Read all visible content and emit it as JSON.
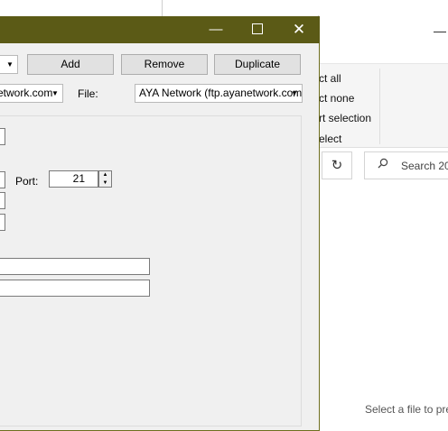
{
  "dialog": {
    "caption_buttons": {
      "minimize": "—",
      "close": "✕"
    },
    "top_combo": {
      "value": ""
    },
    "buttons": {
      "add": "Add",
      "remove": "Remove",
      "duplicate": "Duplicate"
    },
    "host_combo": {
      "value": "etwork.com"
    },
    "file_label": "File:",
    "file_combo": {
      "value": "AYA Network (ftp.ayanetwork.com"
    },
    "port_label": "Port:",
    "port_value": "21"
  },
  "explorer": {
    "ribbon_items": [
      "ct all",
      "ct none",
      "rt selection",
      "elect"
    ],
    "refresh_glyph": "↻",
    "search_placeholder": "Search 20",
    "preview_text": "Select a file to pre"
  },
  "icons": {
    "close": "close-icon",
    "maximize": "maximize-icon",
    "minimize": "minimize-icon",
    "dropdown": "chevron-down-icon",
    "search": "search-icon",
    "refresh": "refresh-icon"
  },
  "colors": {
    "titlebar": "#5b5a16",
    "dialog_bg": "#f0f0f0"
  }
}
